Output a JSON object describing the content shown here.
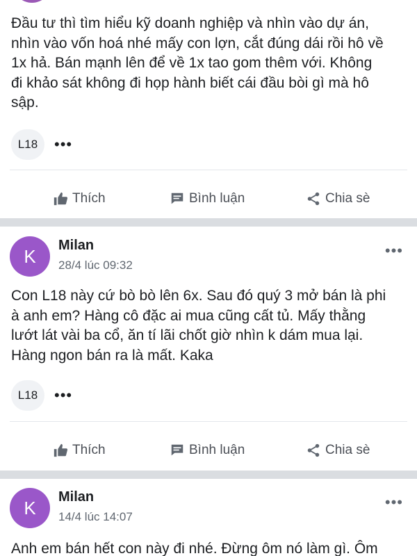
{
  "posts": [
    {
      "text_lines": [
        "Đầu tư thì tìm hiểu kỹ doanh nghiệp và nhìn vào dự án,",
        "nhìn vào vốn hoá nhé mấy con lợn, cắt đúng dái rồi hô về",
        "1x hả. Bán mạnh lên để về 1x tao gom thêm với. Không",
        "đi khảo sát không đi họp hành biết cái đầu bòi gì mà hô",
        "sập."
      ],
      "tag": "L18",
      "tag_more": "•••"
    },
    {
      "author": "Milan",
      "avatar_letter": "K",
      "time": "28/4 lúc 09:32",
      "more": "•••",
      "text_lines": [
        "Con L18 này cứ bò bò lên 6x. Sau đó quý 3 mở bán là phi",
        "à anh em? Hàng cô đặc ai mua cũng cất tủ. Mấy thằng",
        "lướt lát vài ba cổ, ăn tí lãi chốt giờ nhìn k dám mua lại.",
        "Hàng ngon bán ra là mất. Kaka"
      ],
      "tag": "L18",
      "tag_more": "•••"
    },
    {
      "author": "Milan",
      "avatar_letter": "K",
      "time": "14/4 lúc 14:07",
      "more": "•••",
      "text_lines": [
        "Anh em bán hết con này đi nhé. Đừng ôm nó làm gì. Ôm"
      ]
    }
  ],
  "actions": {
    "like": "Thích",
    "comment": "Bình luận",
    "share": "Chia sè"
  },
  "colors": {
    "avatar": "#9a57c9",
    "separator": "#dadde1",
    "action_text": "#4b4f56"
  }
}
